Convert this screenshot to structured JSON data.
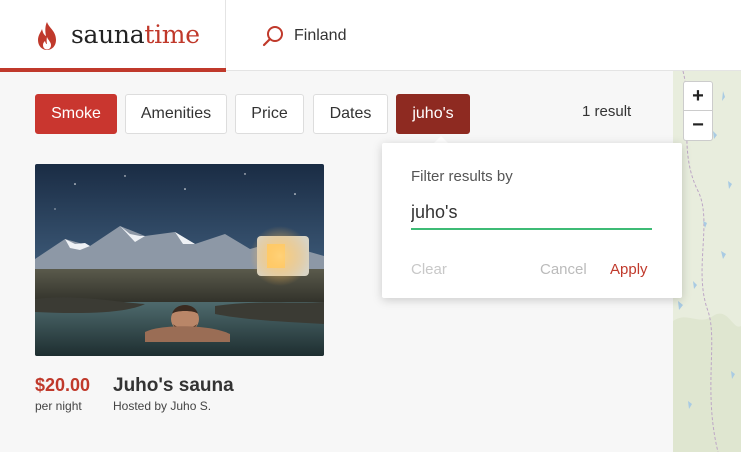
{
  "brand": {
    "name_part1": "sauna",
    "name_part2": "time"
  },
  "search": {
    "value": "Finland"
  },
  "filters": {
    "smoke": "Smoke",
    "amenities": "Amenities",
    "price": "Price",
    "dates": "Dates",
    "query": "juho's"
  },
  "results": {
    "count_text": "1 result"
  },
  "listing": {
    "price": "$20.00",
    "unit": "per night",
    "title": "Juho's sauna",
    "host": "Hosted by Juho S."
  },
  "map": {
    "zoom_in": "+",
    "zoom_out": "−"
  },
  "popover": {
    "label": "Filter results by",
    "input_value": "juho's",
    "clear": "Clear",
    "cancel": "Cancel",
    "apply": "Apply"
  },
  "colors": {
    "accent": "#c0392b",
    "chip_active": "#8e2a21",
    "input_focus": "#3dbb75"
  },
  "icons": {
    "logo": "flame-icon",
    "search": "search-icon"
  }
}
